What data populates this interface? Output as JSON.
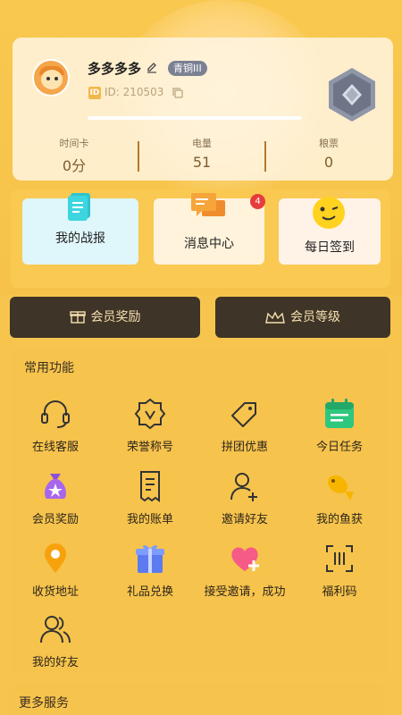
{
  "profile": {
    "username": "多多多多",
    "rank": "青铜III",
    "id_tag": "ID",
    "id_text": "ID: 210503"
  },
  "stats": [
    {
      "label": "时间卡",
      "value": "0分"
    },
    {
      "label": "电量",
      "value": "51"
    },
    {
      "label": "粮票",
      "value": "0"
    }
  ],
  "quick_cards": [
    {
      "label": "我的战报"
    },
    {
      "label": "消息中心",
      "badge": "4"
    },
    {
      "label": "每日签到"
    }
  ],
  "member_buttons": {
    "reward": "会员奖励",
    "level": "会员等级"
  },
  "common": {
    "title": "常用功能",
    "items": [
      {
        "label": "在线客服",
        "icon": "headset-icon"
      },
      {
        "label": "荣誉称号",
        "icon": "honor-badge-icon"
      },
      {
        "label": "拼团优惠",
        "icon": "tag-icon"
      },
      {
        "label": "今日任务",
        "icon": "calendar-icon"
      },
      {
        "label": "会员奖励",
        "icon": "money-bag-icon"
      },
      {
        "label": "我的账单",
        "icon": "bill-icon"
      },
      {
        "label": "邀请好友",
        "icon": "add-user-icon"
      },
      {
        "label": "我的鱼获",
        "icon": "fish-icon"
      },
      {
        "label": "收货地址",
        "icon": "location-pin-icon"
      },
      {
        "label": "礼品兑换",
        "icon": "gift-icon"
      },
      {
        "label": "接受邀请，成功",
        "icon": "heart-plus-icon"
      },
      {
        "label": "福利码",
        "icon": "scan-code-icon"
      },
      {
        "label": "我的好友",
        "icon": "friends-icon"
      }
    ]
  },
  "more": {
    "title": "更多服务"
  },
  "colors": {
    "background": "#f7c54e",
    "dark_button": "#3e3427",
    "badge_red": "#e83c3c",
    "rank_badge": "#7b8193"
  }
}
